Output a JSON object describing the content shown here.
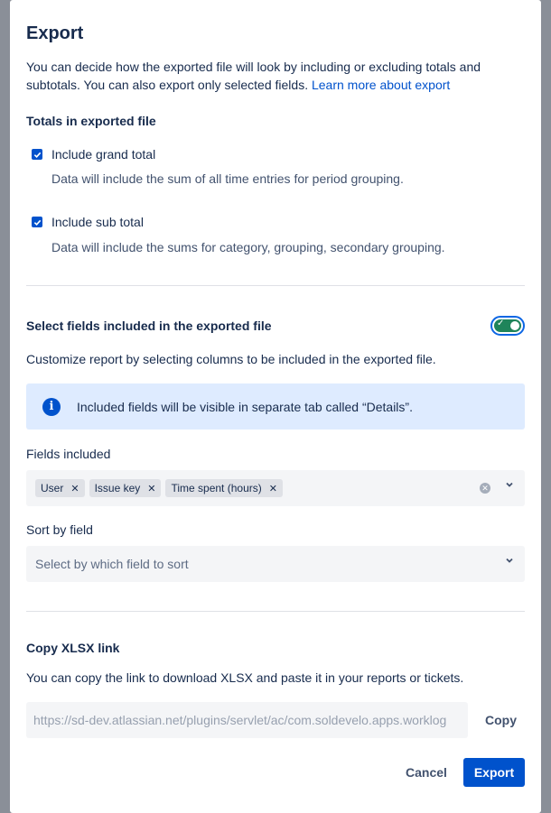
{
  "modal": {
    "title": "Export",
    "intro_text": "You can decide how the exported file will look by including or excluding totals and subtotals. You can also export only selected fields.",
    "intro_link": "Learn more about export"
  },
  "totals": {
    "heading": "Totals in exported file",
    "grand_total": {
      "label": "Include grand total",
      "checked": true,
      "description": "Data will include the sum of all time entries for period grouping."
    },
    "sub_total": {
      "label": "Include sub total",
      "checked": true,
      "description": "Data will include the sums for category, grouping, secondary grouping."
    }
  },
  "fields": {
    "heading": "Select fields included in the exported file",
    "toggle_on": true,
    "description": "Customize report by selecting columns to be included in the exported file.",
    "info_text": "Included fields will be visible in separate tab called “Details”.",
    "fields_label": "Fields included",
    "tags": [
      "User",
      "Issue key",
      "Time spent (hours)"
    ],
    "sort_label": "Sort by field",
    "sort_placeholder": "Select by which field to sort"
  },
  "xlsx": {
    "heading": "Copy XLSX link",
    "description": "You can copy the link to download XLSX and paste it in your reports or tickets.",
    "link_value": "https://sd-dev.atlassian.net/plugins/servlet/ac/com.soldevelo.apps.worklog",
    "copy_label": "Copy"
  },
  "footer": {
    "cancel_label": "Cancel",
    "export_label": "Export"
  },
  "colors": {
    "primary": "#0052cc",
    "toggle_on": "#1f845a",
    "info_bg": "#deebff"
  }
}
